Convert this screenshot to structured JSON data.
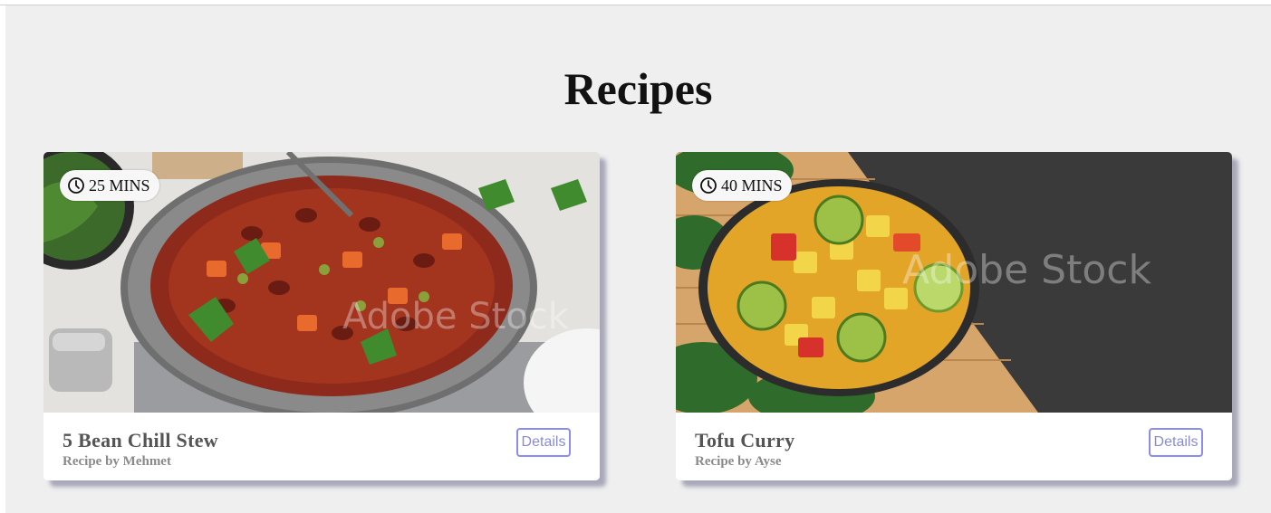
{
  "page": {
    "title": "Recipes"
  },
  "recipes": [
    {
      "time": "25 MINS",
      "name": "5 Bean Chill Stew",
      "author": "Recipe by Mehmet",
      "details_label": "Details",
      "image_watermark": "Adobe Stock"
    },
    {
      "time": "40 MINS",
      "name": "Tofu Curry",
      "author": "Recipe by Ayse",
      "details_label": "Details",
      "image_watermark": "Adobe Stock"
    }
  ],
  "colors": {
    "background": "#efefef",
    "card": "#ffffff",
    "button_border": "#8c8cee",
    "button_text": "#8a8ad6",
    "name_text": "#555555",
    "author_text": "#8a8a8a"
  },
  "icons": {
    "time": "clock-icon"
  }
}
